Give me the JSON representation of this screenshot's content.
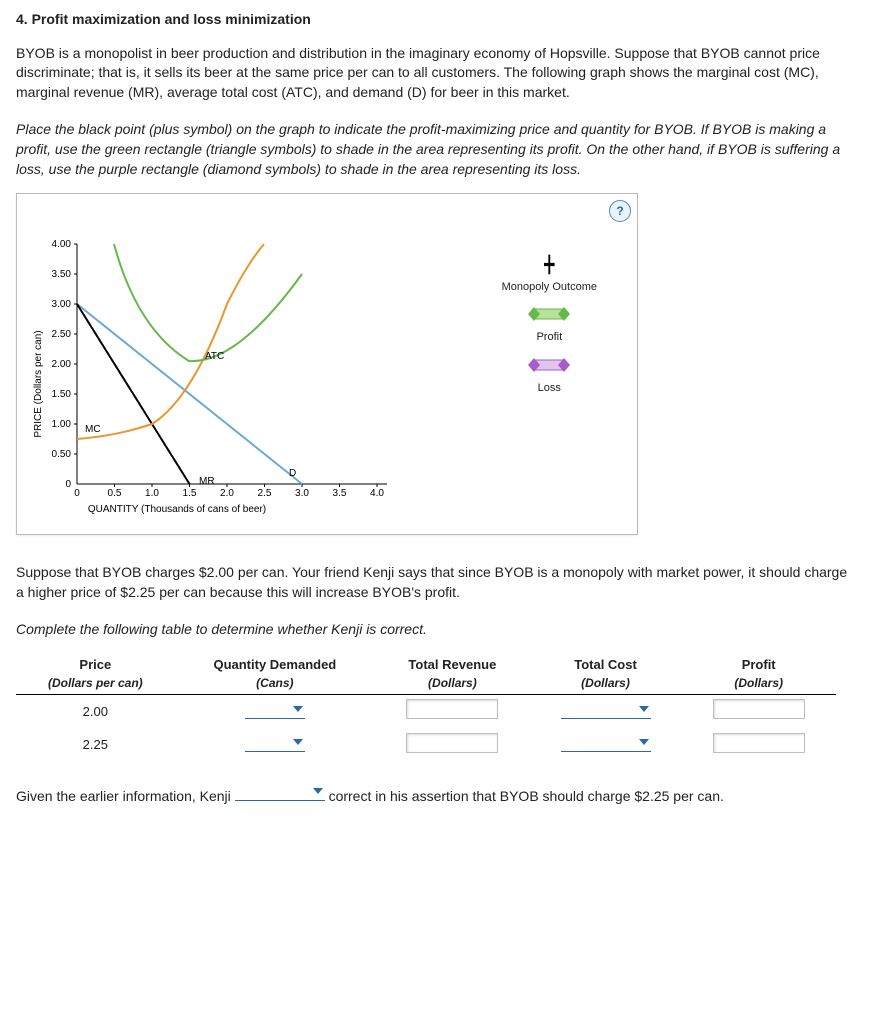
{
  "title": "4. Profit maximization and loss minimization",
  "intro": "BYOB is a monopolist in beer production and distribution in the imaginary economy of Hopsville. Suppose that BYOB cannot price discriminate; that is, it sells its beer at the same price per can to all customers. The following graph shows the marginal cost (MC), marginal revenue (MR), average total cost (ATC), and demand (D) for beer in this market.",
  "instructions": "Place the black point (plus symbol) on the graph to indicate the profit-maximizing price and quantity for BYOB. If BYOB is making a profit, use the green rectangle (triangle symbols) to shade in the area representing its profit. On the other hand, if BYOB is suffering a loss, use the purple rectangle (diamond symbols) to shade in the area representing its loss.",
  "help_label": "?",
  "legend": {
    "monopoly": "Monopoly Outcome",
    "profit": "Profit",
    "loss": "Loss"
  },
  "curve_labels": {
    "mc": "MC",
    "atc": "ATC",
    "mr": "MR",
    "d": "D"
  },
  "axis": {
    "ylabel": "PRICE (Dollars per can)",
    "xlabel": "QUANTITY (Thousands of cans of beer)"
  },
  "chart_data": {
    "type": "line",
    "xlabel": "QUANTITY (Thousands of cans of beer)",
    "ylabel": "PRICE (Dollars per can)",
    "xlim": [
      0,
      4.0
    ],
    "ylim": [
      0,
      4.0
    ],
    "xticks": [
      0,
      0.5,
      1.0,
      1.5,
      2.0,
      2.5,
      3.0,
      3.5,
      4.0
    ],
    "yticks": [
      0,
      0.5,
      1.0,
      1.5,
      2.0,
      2.5,
      3.0,
      3.5,
      4.0
    ],
    "series": [
      {
        "name": "D",
        "color": "#6aa9d8",
        "x": [
          0,
          3.0
        ],
        "y": [
          3.0,
          0
        ]
      },
      {
        "name": "MR",
        "color": "#000000",
        "x": [
          0,
          1.5
        ],
        "y": [
          3.0,
          0
        ]
      },
      {
        "name": "MC",
        "color": "#e8962f",
        "x": [
          0,
          0.5,
          1.0,
          1.5,
          2.0,
          2.5
        ],
        "y": [
          0.75,
          0.8,
          1.0,
          1.8,
          3.0,
          4.0
        ]
      },
      {
        "name": "ATC",
        "color": "#64b94a",
        "x": [
          0.5,
          1.0,
          1.5,
          2.0,
          2.5,
          3.0
        ],
        "y": [
          4.0,
          2.5,
          2.05,
          2.15,
          2.7,
          3.5
        ]
      }
    ]
  },
  "scenario": "Suppose that BYOB charges $2.00 per can. Your friend Kenji says that since BYOB is a monopoly with market power, it should charge a higher price of $2.25 per can because this will increase BYOB's profit.",
  "table_instr": "Complete the following table to determine whether Kenji is correct.",
  "table": {
    "headers": {
      "price": "Price",
      "price_sub": "(Dollars per can)",
      "qd": "Quantity Demanded",
      "qd_sub": "(Cans)",
      "tr": "Total Revenue",
      "tr_sub": "(Dollars)",
      "tc": "Total Cost",
      "tc_sub": "(Dollars)",
      "profit": "Profit",
      "profit_sub": "(Dollars)"
    },
    "rows": [
      {
        "price": "2.00"
      },
      {
        "price": "2.25"
      }
    ]
  },
  "conclusion_pre": "Given the earlier information, Kenji",
  "conclusion_post": "correct in his assertion that BYOB should charge $2.25 per can."
}
